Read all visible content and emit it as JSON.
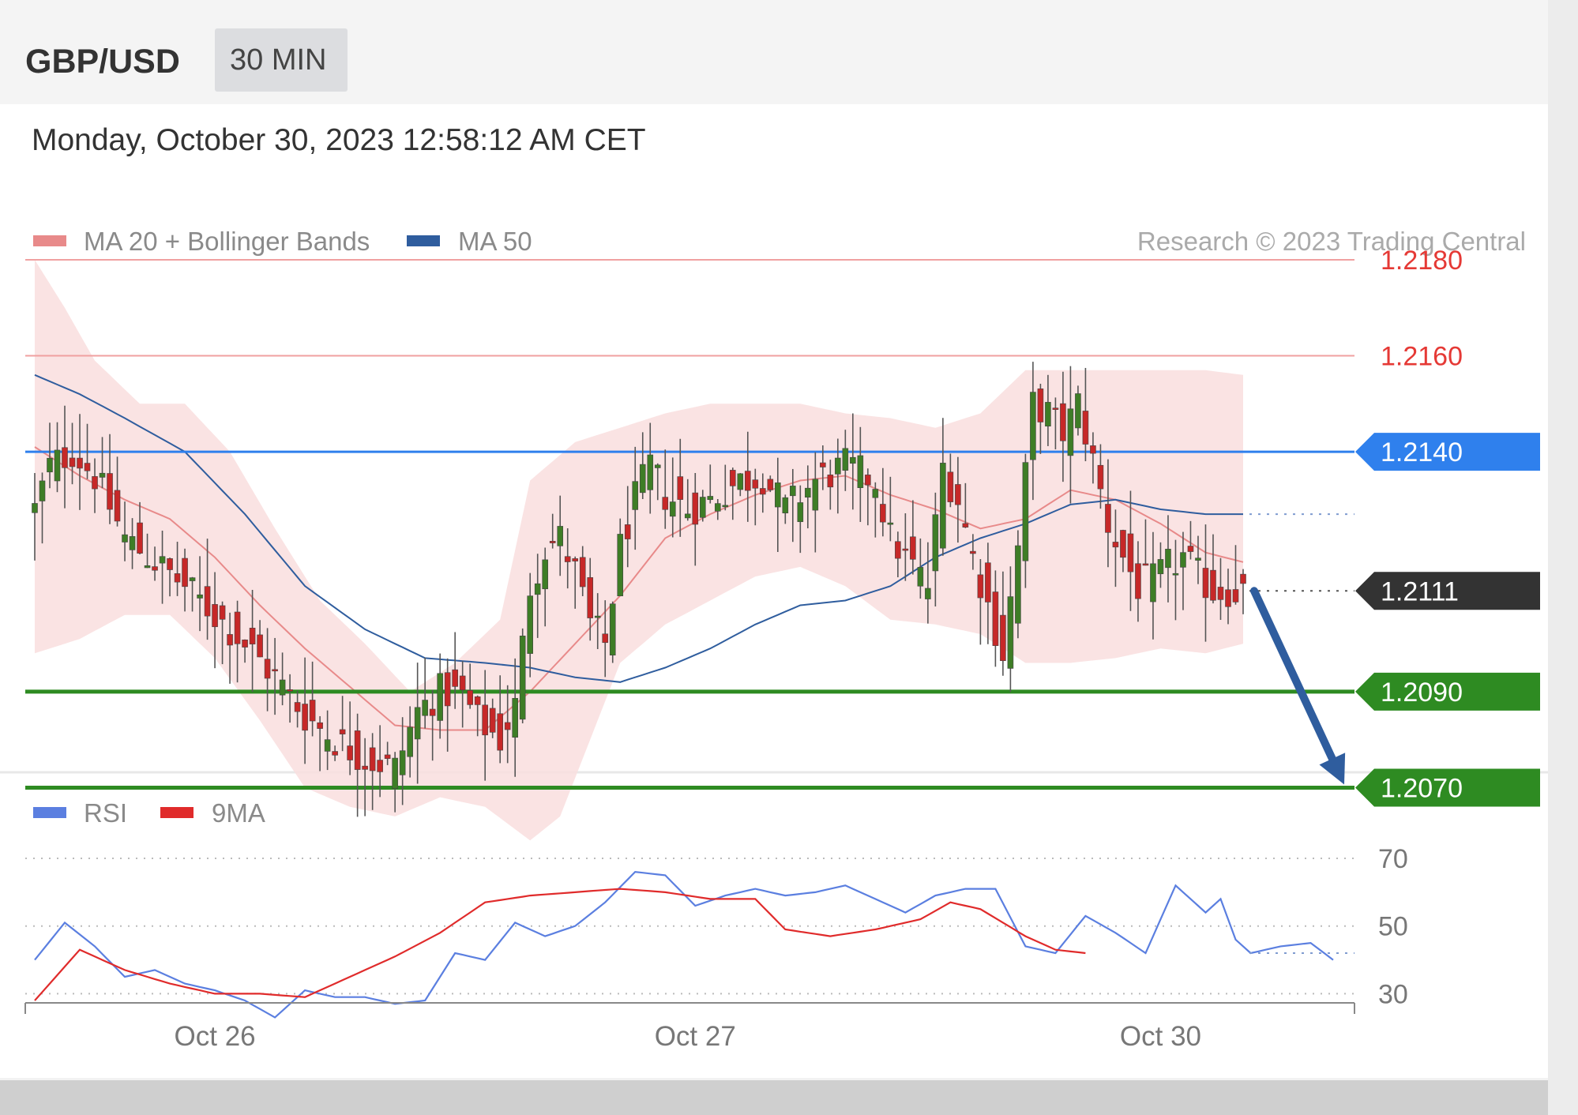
{
  "header": {
    "pair": "GBP/USD",
    "timeframe": "30 MIN",
    "timestamp": "Monday, October 30, 2023 12:58:12 AM CET"
  },
  "legend": {
    "ma20": {
      "label": "MA 20 + Bollinger Bands",
      "color": "#e88a8a"
    },
    "ma50": {
      "label": "MA 50",
      "color": "#2f5d9e"
    },
    "copyright": "Research © 2023 Trading Central"
  },
  "rsi_legend": {
    "rsi": {
      "label": "RSI",
      "color": "#5b7fe0"
    },
    "ma9": {
      "label": "9MA",
      "color": "#e02b2b"
    }
  },
  "chart_data": [
    {
      "type": "candlestick",
      "title": "GBP/USD",
      "timeframe": "30 MIN",
      "ylim": [
        1.2063,
        1.2193
      ],
      "x_ticks": [
        {
          "label": "Oct 26",
          "bar": 24
        },
        {
          "label": "Oct 27",
          "bar": 88
        },
        {
          "label": "Oct 30",
          "bar": 150
        }
      ],
      "bar_count": 162,
      "levels": [
        {
          "value": 1.218,
          "label": "1.2180",
          "kind": "resistance",
          "color": "#e53935"
        },
        {
          "value": 1.216,
          "label": "1.2160",
          "kind": "resistance",
          "color": "#e53935"
        },
        {
          "value": 1.214,
          "label": "1.2140",
          "kind": "pivot",
          "color": "#2f80ed"
        },
        {
          "value": 1.2111,
          "label": "1.2111",
          "kind": "last",
          "color": "#333333"
        },
        {
          "value": 1.209,
          "label": "1.2090",
          "kind": "support",
          "color": "#2e8b22"
        },
        {
          "value": 1.207,
          "label": "1.2070",
          "kind": "support",
          "color": "#2e8b22"
        }
      ],
      "arrow": {
        "from_value": 1.2111,
        "to_value": 1.207,
        "color": "#2f5d9e"
      },
      "close_keypoints": [
        [
          0,
          1.2128
        ],
        [
          2,
          1.2137
        ],
        [
          5,
          1.214
        ],
        [
          8,
          1.2135
        ],
        [
          12,
          1.2122
        ],
        [
          16,
          1.2117
        ],
        [
          20,
          1.2112
        ],
        [
          24,
          1.2106
        ],
        [
          28,
          1.21
        ],
        [
          32,
          1.2093
        ],
        [
          36,
          1.2085
        ],
        [
          40,
          1.208
        ],
        [
          44,
          1.2076
        ],
        [
          48,
          1.2074
        ],
        [
          51,
          1.2086
        ],
        [
          54,
          1.209
        ],
        [
          57,
          1.2089
        ],
        [
          59,
          1.2084
        ],
        [
          62,
          1.208
        ],
        [
          64,
          1.2087
        ],
        [
          66,
          1.2112
        ],
        [
          68,
          1.212
        ],
        [
          70,
          1.2122
        ],
        [
          72,
          1.2115
        ],
        [
          74,
          1.2104
        ],
        [
          76,
          1.21
        ],
        [
          78,
          1.212
        ],
        [
          80,
          1.213
        ],
        [
          82,
          1.2137
        ],
        [
          84,
          1.2131
        ],
        [
          87,
          1.2128
        ],
        [
          90,
          1.213
        ],
        [
          94,
          1.2134
        ],
        [
          97,
          1.2135
        ],
        [
          100,
          1.2128
        ],
        [
          104,
          1.2134
        ],
        [
          108,
          1.2137
        ],
        [
          112,
          1.2134
        ],
        [
          114,
          1.2122
        ],
        [
          117,
          1.2116
        ],
        [
          119,
          1.2112
        ],
        [
          121,
          1.2137
        ],
        [
          123,
          1.213
        ],
        [
          125,
          1.2118
        ],
        [
          127,
          1.2108
        ],
        [
          129,
          1.2098
        ],
        [
          131,
          1.212
        ],
        [
          133,
          1.215
        ],
        [
          135,
          1.2148
        ],
        [
          137,
          1.2144
        ],
        [
          139,
          1.215
        ],
        [
          141,
          1.2138
        ],
        [
          143,
          1.2125
        ],
        [
          145,
          1.2118
        ],
        [
          147,
          1.2112
        ],
        [
          149,
          1.2113
        ],
        [
          151,
          1.2116
        ],
        [
          153,
          1.2118
        ],
        [
          155,
          1.2114
        ],
        [
          157,
          1.2111
        ],
        [
          161,
          1.2111
        ]
      ],
      "ma20_keypoints": [
        [
          0,
          1.2141
        ],
        [
          6,
          1.2135
        ],
        [
          12,
          1.213
        ],
        [
          18,
          1.2126
        ],
        [
          24,
          1.2118
        ],
        [
          30,
          1.2108
        ],
        [
          36,
          1.2099
        ],
        [
          42,
          1.2091
        ],
        [
          48,
          1.2083
        ],
        [
          54,
          1.2082
        ],
        [
          60,
          1.2082
        ],
        [
          66,
          1.209
        ],
        [
          72,
          1.21
        ],
        [
          78,
          1.211
        ],
        [
          84,
          1.2122
        ],
        [
          90,
          1.2127
        ],
        [
          96,
          1.2131
        ],
        [
          102,
          1.2134
        ],
        [
          108,
          1.2135
        ],
        [
          114,
          1.2131
        ],
        [
          120,
          1.2128
        ],
        [
          126,
          1.2124
        ],
        [
          132,
          1.2126
        ],
        [
          138,
          1.2132
        ],
        [
          144,
          1.213
        ],
        [
          150,
          1.2125
        ],
        [
          156,
          1.2119
        ],
        [
          161,
          1.2117
        ]
      ],
      "bb_upper_keypoints": [
        [
          0,
          1.218
        ],
        [
          4,
          1.217
        ],
        [
          8,
          1.2159
        ],
        [
          14,
          1.215
        ],
        [
          20,
          1.215
        ],
        [
          26,
          1.214
        ],
        [
          32,
          1.2124
        ],
        [
          38,
          1.2109
        ],
        [
          44,
          1.21
        ],
        [
          50,
          1.209
        ],
        [
          56,
          1.2096
        ],
        [
          62,
          1.2105
        ],
        [
          66,
          1.2134
        ],
        [
          72,
          1.2142
        ],
        [
          78,
          1.2145
        ],
        [
          84,
          1.2148
        ],
        [
          90,
          1.215
        ],
        [
          96,
          1.215
        ],
        [
          102,
          1.215
        ],
        [
          108,
          1.2148
        ],
        [
          114,
          1.2147
        ],
        [
          120,
          1.2145
        ],
        [
          126,
          1.2148
        ],
        [
          132,
          1.2157
        ],
        [
          138,
          1.2157
        ],
        [
          144,
          1.2157
        ],
        [
          150,
          1.2157
        ],
        [
          156,
          1.2157
        ],
        [
          161,
          1.2156
        ]
      ],
      "bb_lower_keypoints": [
        [
          0,
          1.2098
        ],
        [
          6,
          1.2101
        ],
        [
          12,
          1.2106
        ],
        [
          18,
          1.2106
        ],
        [
          24,
          1.2097
        ],
        [
          30,
          1.2084
        ],
        [
          36,
          1.207
        ],
        [
          42,
          1.2066
        ],
        [
          48,
          1.2064
        ],
        [
          54,
          1.2068
        ],
        [
          60,
          1.2066
        ],
        [
          66,
          1.2059
        ],
        [
          70,
          1.2064
        ],
        [
          74,
          1.208
        ],
        [
          78,
          1.2096
        ],
        [
          84,
          1.2104
        ],
        [
          90,
          1.2109
        ],
        [
          96,
          1.2114
        ],
        [
          102,
          1.2116
        ],
        [
          108,
          1.2112
        ],
        [
          114,
          1.2105
        ],
        [
          120,
          1.2104
        ],
        [
          126,
          1.2102
        ],
        [
          132,
          1.2096
        ],
        [
          138,
          1.2096
        ],
        [
          144,
          1.2097
        ],
        [
          150,
          1.2099
        ],
        [
          156,
          1.2098
        ],
        [
          161,
          1.21
        ]
      ],
      "ma50_keypoints": [
        [
          0,
          1.2156
        ],
        [
          6,
          1.2152
        ],
        [
          12,
          1.2147
        ],
        [
          20,
          1.214
        ],
        [
          28,
          1.2127
        ],
        [
          36,
          1.2112
        ],
        [
          44,
          1.2103
        ],
        [
          52,
          1.2097
        ],
        [
          60,
          1.2096
        ],
        [
          66,
          1.2095
        ],
        [
          72,
          1.2093
        ],
        [
          78,
          1.2092
        ],
        [
          84,
          1.2095
        ],
        [
          90,
          1.2099
        ],
        [
          96,
          1.2104
        ],
        [
          102,
          1.2108
        ],
        [
          108,
          1.2109
        ],
        [
          114,
          1.2112
        ],
        [
          120,
          1.2118
        ],
        [
          126,
          1.2122
        ],
        [
          132,
          1.2125
        ],
        [
          138,
          1.2129
        ],
        [
          144,
          1.213
        ],
        [
          150,
          1.2128
        ],
        [
          156,
          1.2127
        ],
        [
          161,
          1.2127
        ]
      ]
    },
    {
      "type": "line",
      "title": "RSI",
      "ylim": [
        21,
        77
      ],
      "grid_levels": [
        70,
        50,
        30
      ],
      "y_ticks": [
        "70",
        "50",
        "30"
      ],
      "series": [
        {
          "name": "RSI",
          "color": "#5b7fe0",
          "keypoints": [
            [
              0,
              40
            ],
            [
              4,
              51
            ],
            [
              8,
              44
            ],
            [
              12,
              35
            ],
            [
              16,
              37
            ],
            [
              20,
              33
            ],
            [
              24,
              31
            ],
            [
              28,
              28
            ],
            [
              32,
              23
            ],
            [
              36,
              31
            ],
            [
              40,
              29
            ],
            [
              44,
              29
            ],
            [
              48,
              27
            ],
            [
              52,
              28
            ],
            [
              56,
              42
            ],
            [
              60,
              40
            ],
            [
              64,
              51
            ],
            [
              68,
              47
            ],
            [
              72,
              50
            ],
            [
              76,
              57
            ],
            [
              80,
              66
            ],
            [
              84,
              65
            ],
            [
              88,
              56
            ],
            [
              92,
              59
            ],
            [
              96,
              61
            ],
            [
              100,
              59
            ],
            [
              104,
              60
            ],
            [
              108,
              62
            ],
            [
              112,
              58
            ],
            [
              116,
              54
            ],
            [
              120,
              59
            ],
            [
              124,
              61
            ],
            [
              128,
              61
            ],
            [
              132,
              44
            ],
            [
              136,
              42
            ],
            [
              140,
              53
            ],
            [
              144,
              48
            ],
            [
              148,
              42
            ],
            [
              152,
              62
            ],
            [
              156,
              54
            ],
            [
              158,
              58
            ],
            [
              160,
              46
            ],
            [
              162,
              42
            ],
            [
              166,
              44
            ],
            [
              170,
              45
            ],
            [
              173,
              40
            ]
          ]
        },
        {
          "name": "9MA",
          "color": "#e02b2b",
          "keypoints": [
            [
              0,
              28
            ],
            [
              6,
              43
            ],
            [
              12,
              37
            ],
            [
              18,
              33
            ],
            [
              24,
              30
            ],
            [
              30,
              30
            ],
            [
              36,
              29
            ],
            [
              42,
              35
            ],
            [
              48,
              41
            ],
            [
              54,
              48
            ],
            [
              60,
              57
            ],
            [
              66,
              59
            ],
            [
              72,
              60
            ],
            [
              78,
              61
            ],
            [
              84,
              60
            ],
            [
              90,
              58
            ],
            [
              96,
              58
            ],
            [
              100,
              49
            ],
            [
              106,
              47
            ],
            [
              112,
              49
            ],
            [
              118,
              52
            ],
            [
              122,
              57
            ],
            [
              126,
              55
            ],
            [
              132,
              47
            ],
            [
              136,
              43
            ],
            [
              140,
              42
            ]
          ]
        }
      ],
      "last_value": 42
    }
  ],
  "axis": {
    "dates": [
      "Oct 26",
      "Oct 27",
      "Oct 30"
    ]
  }
}
